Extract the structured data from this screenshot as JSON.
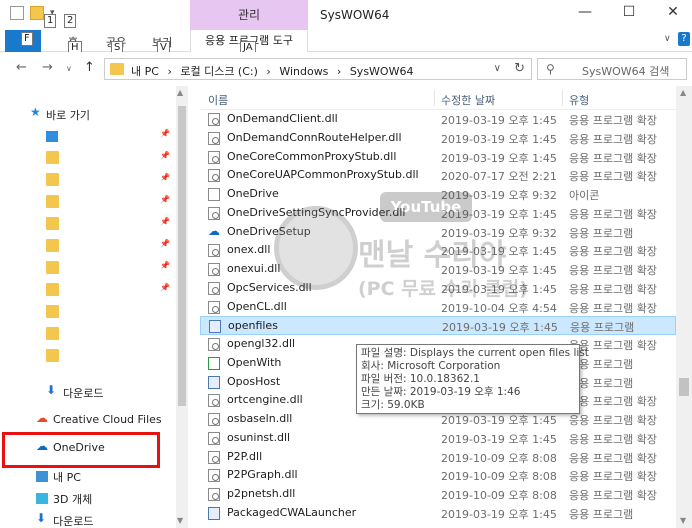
{
  "window": {
    "title": "SysWOW64",
    "context_tab": "관리",
    "controls": {
      "minimize": "—",
      "maximize": "☐",
      "close": "✕"
    },
    "qat_keytips": [
      "1",
      "2"
    ]
  },
  "ribbon": {
    "file_keytip": "F",
    "tabs": [
      {
        "label": "홈",
        "keytip": "H"
      },
      {
        "label": "공유",
        "keytip": "S"
      },
      {
        "label": "보기",
        "keytip": "V"
      }
    ],
    "context_subtab": "응용 프로그램 도구",
    "context_keytip": "JA",
    "help": "?"
  },
  "address": {
    "segments": [
      "내 PC",
      "›",
      "로컬 디스크 (C:)",
      "›",
      "Windows",
      "›",
      "SysWOW64"
    ],
    "search_placeholder": "SysWOW64 검색"
  },
  "nav": {
    "items": [
      {
        "label": "바로 가기",
        "icon": "star-icon"
      },
      {
        "label": "",
        "icon": "desktop-icon",
        "pin": true
      },
      {
        "label": "",
        "icon": "folder-icon",
        "pin": true
      },
      {
        "label": "",
        "icon": "folder-icon",
        "pin": true
      },
      {
        "label": "",
        "icon": "folder-icon",
        "pin": true
      },
      {
        "label": "",
        "icon": "folder-icon",
        "pin": true
      },
      {
        "label": "",
        "icon": "folder-icon",
        "pin": true
      },
      {
        "label": "",
        "icon": "folder-icon",
        "pin": true
      },
      {
        "label": "",
        "icon": "folder-icon",
        "pin": true
      },
      {
        "label": "",
        "icon": "folder-icon"
      },
      {
        "label": "",
        "icon": "folder-icon"
      },
      {
        "label": "",
        "icon": "folder-icon"
      },
      {
        "label": "다운로드",
        "icon": "download-icon"
      },
      {
        "label": "Creative Cloud Files",
        "icon": "creative-cloud-icon"
      },
      {
        "label": "OneDrive",
        "icon": "onedrive-icon"
      },
      {
        "label": "내 PC",
        "icon": "pc-icon"
      },
      {
        "label": "3D 개체",
        "icon": "3d-objects-icon"
      },
      {
        "label": "다운로드",
        "icon": "download-icon"
      }
    ]
  },
  "columns": {
    "name": "이름",
    "date": "수정한 날짜",
    "type": "유형"
  },
  "files": [
    {
      "name": "OnDemandClient.dll",
      "date": "2019-03-19 오후 1:45",
      "type": "응용 프로그램 확장",
      "icon": "dll"
    },
    {
      "name": "OnDemandConnRouteHelper.dll",
      "date": "2019-03-19 오후 1:45",
      "type": "응용 프로그램 확장",
      "icon": "dll"
    },
    {
      "name": "OneCoreCommonProxyStub.dll",
      "date": "2019-03-19 오후 1:45",
      "type": "응용 프로그램 확장",
      "icon": "dll"
    },
    {
      "name": "OneCoreUAPCommonProxyStub.dll",
      "date": "2020-07-17 오전 2:21",
      "type": "응용 프로그램 확장",
      "icon": "dll"
    },
    {
      "name": "OneDrive",
      "date": "2019-03-19 오후 9:32",
      "type": "아이콘",
      "icon": "blank"
    },
    {
      "name": "OneDriveSettingSyncProvider.dll",
      "date": "2019-03-19 오후 1:45",
      "type": "응용 프로그램 확장",
      "icon": "dll"
    },
    {
      "name": "OneDriveSetup",
      "date": "2019-03-19 오후 9:32",
      "type": "응용 프로그램",
      "icon": "cloud"
    },
    {
      "name": "onex.dll",
      "date": "2019-03-19 오후 1:45",
      "type": "응용 프로그램 확장",
      "icon": "dll"
    },
    {
      "name": "onexui.dll",
      "date": "2019-03-19 오후 1:45",
      "type": "응용 프로그램 확장",
      "icon": "dll"
    },
    {
      "name": "OpcServices.dll",
      "date": "2019-03-19 오후 1:45",
      "type": "응용 프로그램 확장",
      "icon": "dll"
    },
    {
      "name": "OpenCL.dll",
      "date": "2019-10-04 오후 4:54",
      "type": "응용 프로그램 확장",
      "icon": "dll"
    },
    {
      "name": "openfiles",
      "date": "2019-03-19 오후 1:45",
      "type": "응용 프로그램",
      "icon": "app",
      "selected": true
    },
    {
      "name": "opengl32.dll",
      "date": "",
      "type": "응용 프로그램 확장",
      "icon": "dll"
    },
    {
      "name": "OpenWith",
      "date": "",
      "type": "응용 프로그램",
      "icon": "green"
    },
    {
      "name": "OposHost",
      "date": "",
      "type": "응용 프로그램",
      "icon": "app"
    },
    {
      "name": "ortcengine.dll",
      "date": "",
      "type": "응용 프로그램 확장",
      "icon": "dll"
    },
    {
      "name": "osbaseln.dll",
      "date": "2019-03-19 오후 1:45",
      "type": "응용 프로그램 확장",
      "icon": "dll"
    },
    {
      "name": "osuninst.dll",
      "date": "2019-03-19 오후 1:45",
      "type": "응용 프로그램 확장",
      "icon": "dll"
    },
    {
      "name": "P2P.dll",
      "date": "2019-10-09 오후 8:08",
      "type": "응용 프로그램 확장",
      "icon": "dll"
    },
    {
      "name": "P2PGraph.dll",
      "date": "2019-10-09 오후 8:08",
      "type": "응용 프로그램 확장",
      "icon": "dll"
    },
    {
      "name": "p2pnetsh.dll",
      "date": "2019-10-09 오후 8:08",
      "type": "응용 프로그램 확장",
      "icon": "dll"
    },
    {
      "name": "PackagedCWALauncher",
      "date": "2019-03-19 오후 1:45",
      "type": "응용 프로그램",
      "icon": "app"
    }
  ],
  "tooltip": {
    "lines": [
      "파일 설명: Displays the current open files list",
      "회사: Microsoft Corporation",
      "파일 버전: 10.0.18362.1",
      "만든 날짜: 2019-03-19 오후 1:46",
      "크기: 59.0KB"
    ]
  },
  "watermark": {
    "yt": "YouTube",
    "title": "맨날 수리야",
    "subtitle": "(PC 무료 수리 클립)"
  },
  "colors": {
    "accent": "#1979ca",
    "context_tab": "#e8c6f2",
    "selection": "#cce8ff",
    "highlight_box": "#e81010"
  }
}
